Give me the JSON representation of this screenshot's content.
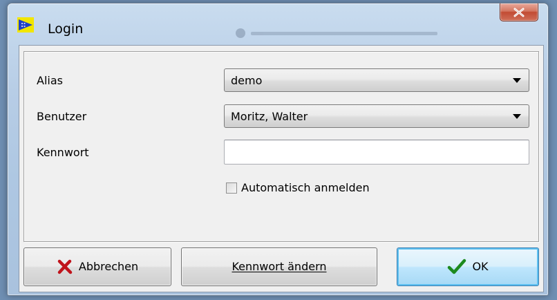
{
  "window": {
    "title": "Login",
    "app_icon": "flag-icon",
    "close_icon": "close-x-icon"
  },
  "form": {
    "alias_label": "Alias",
    "alias_value": "demo",
    "user_label": "Benutzer",
    "user_value": "Moritz, Walter",
    "password_label": "Kennwort",
    "password_value": "",
    "auto_login_label": "Automatisch anmelden",
    "auto_login_checked": false
  },
  "buttons": {
    "cancel_label": "Abbrechen",
    "cancel_icon": "red-x-icon",
    "change_password_label": "Kennwort ändern",
    "ok_label": "OK",
    "ok_icon": "green-checkmark-icon"
  },
  "colors": {
    "cancel_icon": "#c0141c",
    "ok_icon": "#1d8a1d",
    "close_button": "#c24b33"
  }
}
